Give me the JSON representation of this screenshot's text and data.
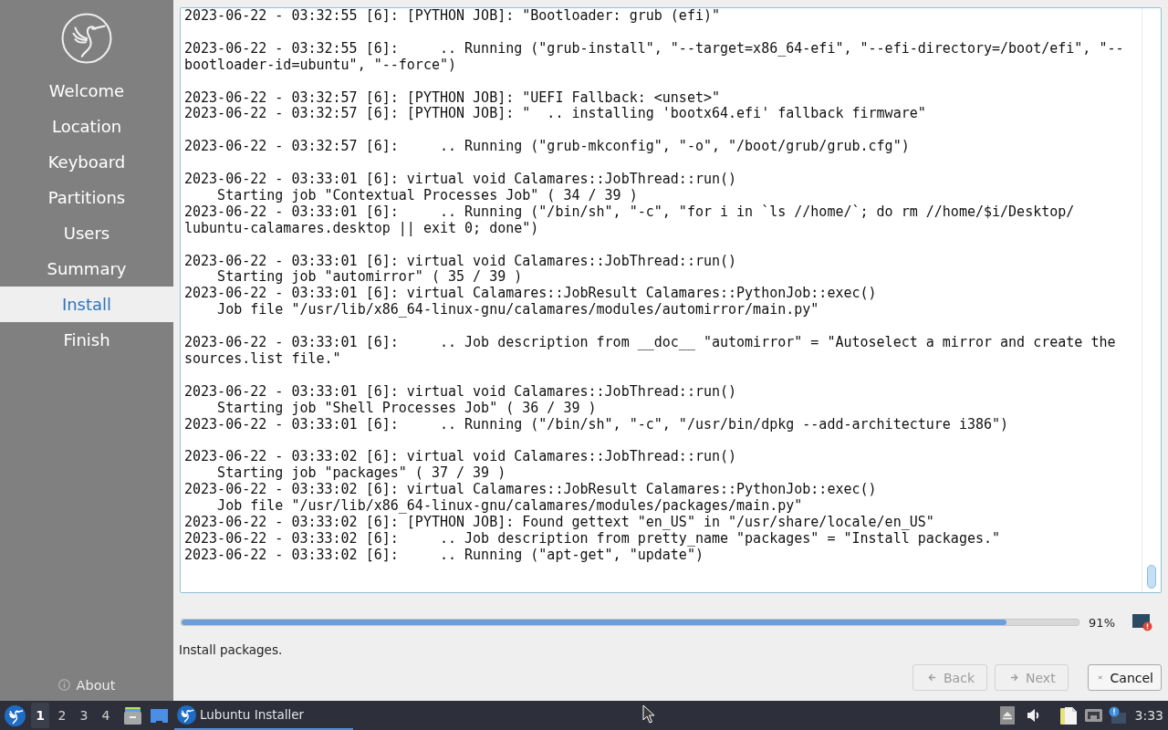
{
  "sidebar": {
    "steps": [
      {
        "label": "Welcome",
        "selected": false
      },
      {
        "label": "Location",
        "selected": false
      },
      {
        "label": "Keyboard",
        "selected": false
      },
      {
        "label": "Partitions",
        "selected": false
      },
      {
        "label": "Users",
        "selected": false
      },
      {
        "label": "Summary",
        "selected": false
      },
      {
        "label": "Install",
        "selected": true
      },
      {
        "label": "Finish",
        "selected": false
      }
    ],
    "about": {
      "label": "About"
    }
  },
  "log": {
    "blocks": [
      [
        "2023-06-22 - 03:32:55 [6]: [PYTHON JOB]: \"Bootloader: grub (efi)\""
      ],
      [
        "2023-06-22 - 03:32:55 [6]:     .. Running (\"grub-install\", \"--target=x86_64-efi\", \"--efi-directory=/boot/efi\", \"--",
        "bootloader-id=ubuntu\", \"--force\")"
      ],
      [
        "2023-06-22 - 03:32:57 [6]: [PYTHON JOB]: \"UEFI Fallback: <unset>\"",
        "2023-06-22 - 03:32:57 [6]: [PYTHON JOB]: \"  .. installing 'bootx64.efi' fallback firmware\""
      ],
      [
        "2023-06-22 - 03:32:57 [6]:     .. Running (\"grub-mkconfig\", \"-o\", \"/boot/grub/grub.cfg\")"
      ],
      [
        "2023-06-22 - 03:33:01 [6]: virtual void Calamares::JobThread::run()",
        "    Starting job \"Contextual Processes Job\" ( 34 / 39 )",
        "2023-06-22 - 03:33:01 [6]:     .. Running (\"/bin/sh\", \"-c\", \"for i in `ls //home/`; do rm //home/$i/Desktop/",
        "lubuntu-calamares.desktop || exit 0; done\")"
      ],
      [
        "2023-06-22 - 03:33:01 [6]: virtual void Calamares::JobThread::run()",
        "    Starting job \"automirror\" ( 35 / 39 )",
        "2023-06-22 - 03:33:01 [6]: virtual Calamares::JobResult Calamares::PythonJob::exec()",
        "    Job file \"/usr/lib/x86_64-linux-gnu/calamares/modules/automirror/main.py\""
      ],
      [
        "2023-06-22 - 03:33:01 [6]:     .. Job description from __doc__ \"automirror\" = \"Autoselect a mirror and create the",
        "sources.list file.\""
      ],
      [
        "2023-06-22 - 03:33:01 [6]: virtual void Calamares::JobThread::run()",
        "    Starting job \"Shell Processes Job\" ( 36 / 39 )",
        "2023-06-22 - 03:33:01 [6]:     .. Running (\"/bin/sh\", \"-c\", \"/usr/bin/dpkg --add-architecture i386\")"
      ],
      [
        "2023-06-22 - 03:33:02 [6]: virtual void Calamares::JobThread::run()",
        "    Starting job \"packages\" ( 37 / 39 )",
        "2023-06-22 - 03:33:02 [6]: virtual Calamares::JobResult Calamares::PythonJob::exec()",
        "    Job file \"/usr/lib/x86_64-linux-gnu/calamares/modules/packages/main.py\"",
        "2023-06-22 - 03:33:02 [6]: [PYTHON JOB]: Found gettext \"en_US\" in \"/usr/share/locale/en_US\"",
        "2023-06-22 - 03:33:02 [6]:     .. Job description from pretty_name \"packages\" = \"Install packages.\"",
        "2023-06-22 - 03:33:02 [6]:     .. Running (\"apt-get\", \"update\")"
      ]
    ]
  },
  "progress": {
    "level": 0.92,
    "percent": "91%"
  },
  "status": "Install packages.",
  "buttons": [
    {
      "label": "Back",
      "kind": "back",
      "disabled": true
    },
    {
      "label": "Next",
      "kind": "next",
      "disabled": true
    },
    {
      "label": "Cancel",
      "kind": "cancel",
      "disabled": false
    }
  ],
  "taskbar": {
    "desktops": [
      {
        "label": "1",
        "selected": true
      },
      {
        "label": "2",
        "selected": false
      },
      {
        "label": "3",
        "selected": false
      },
      {
        "label": "4",
        "selected": false
      }
    ],
    "tasks": [
      {
        "label": "Lubuntu Installer",
        "selected": true
      }
    ],
    "clock": "3:33"
  }
}
